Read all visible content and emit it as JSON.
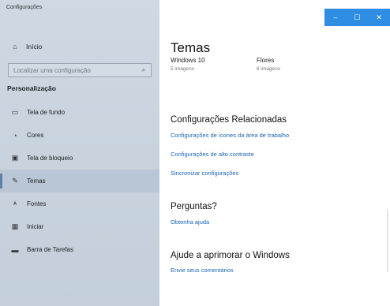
{
  "window": {
    "app_title": "Configurações",
    "controls": {
      "minimize": "–",
      "maximize": "☐",
      "close": "✕"
    }
  },
  "sidebar": {
    "home": {
      "icon": "home-icon",
      "label": "Início"
    },
    "search": {
      "placeholder": "Localizar uma configuração",
      "icon": "search-icon"
    },
    "section_title": "Personalização",
    "items": [
      {
        "label": "Tela de fundo",
        "icon": "picture-icon",
        "selected": false
      },
      {
        "label": "Cores",
        "icon": "palette-icon",
        "selected": false
      },
      {
        "label": "Tela de bloqueio",
        "icon": "lock-screen-icon",
        "selected": false
      },
      {
        "label": "Temas",
        "icon": "brush-icon",
        "selected": true
      },
      {
        "label": "Fontes",
        "icon": "font-icon",
        "selected": false
      },
      {
        "label": "Iniciar",
        "icon": "start-grid-icon",
        "selected": false
      },
      {
        "label": "Barra de Tarefas",
        "icon": "taskbar-icon",
        "selected": false
      }
    ]
  },
  "main": {
    "title": "Temas",
    "themes": [
      {
        "name": "Windows 10",
        "count": "5 imagens"
      },
      {
        "name": "Flores",
        "count": "6 imagens"
      }
    ],
    "related": {
      "heading": "Configurações Relacionadas",
      "links": [
        "Configurações de ícones da área de trabalho",
        "Configurações de alto contraste",
        "Sincronizar configurações"
      ]
    },
    "questions": {
      "heading": "Perguntas?",
      "link": "Obtenha ajuda"
    },
    "improve": {
      "heading": "Ajude a aprimorar o Windows",
      "link": "Envie seus comentários"
    }
  },
  "colors": {
    "accent": "#2f8de4",
    "link": "#1a63b5",
    "sidebar": "#c9d4df"
  }
}
